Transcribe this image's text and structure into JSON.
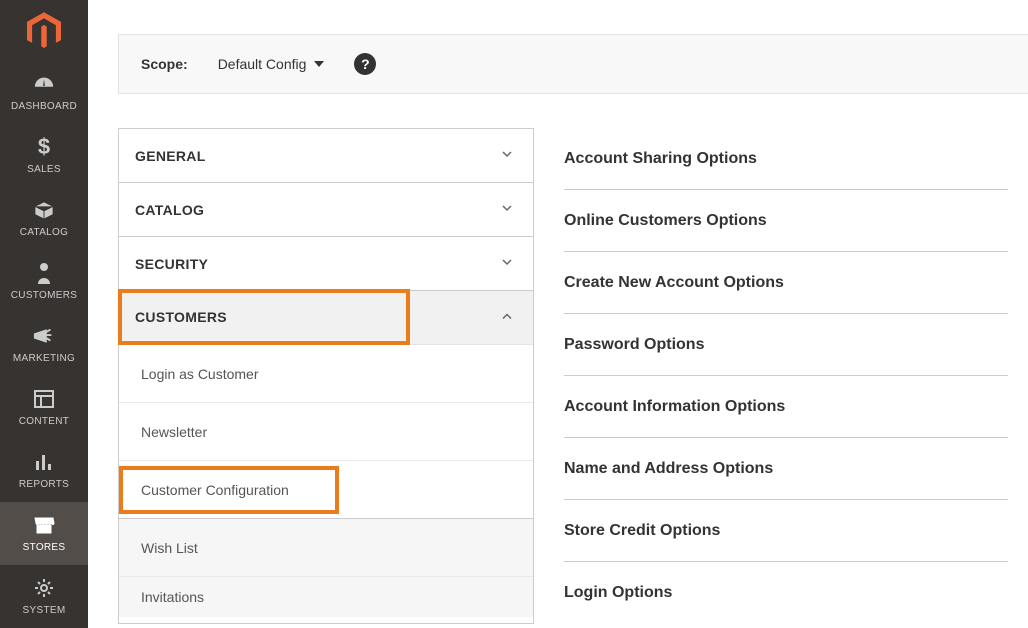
{
  "sidebar": {
    "items": [
      {
        "label": "DASHBOARD"
      },
      {
        "label": "SALES"
      },
      {
        "label": "CATALOG"
      },
      {
        "label": "CUSTOMERS"
      },
      {
        "label": "MARKETING"
      },
      {
        "label": "CONTENT"
      },
      {
        "label": "REPORTS"
      },
      {
        "label": "STORES"
      },
      {
        "label": "SYSTEM"
      }
    ]
  },
  "scope": {
    "label": "Scope:",
    "value": "Default Config"
  },
  "configSections": {
    "general": "GENERAL",
    "catalog": "CATALOG",
    "security": "SECURITY",
    "customers": "CUSTOMERS"
  },
  "customersSub": {
    "login_as_customer": "Login as Customer",
    "newsletter": "Newsletter",
    "customer_configuration": "Customer Configuration",
    "wish_list": "Wish List",
    "invitations": "Invitations"
  },
  "settingsGroups": [
    "Account Sharing Options",
    "Online Customers Options",
    "Create New Account Options",
    "Password Options",
    "Account Information Options",
    "Name and Address Options",
    "Store Credit Options",
    "Login Options"
  ]
}
